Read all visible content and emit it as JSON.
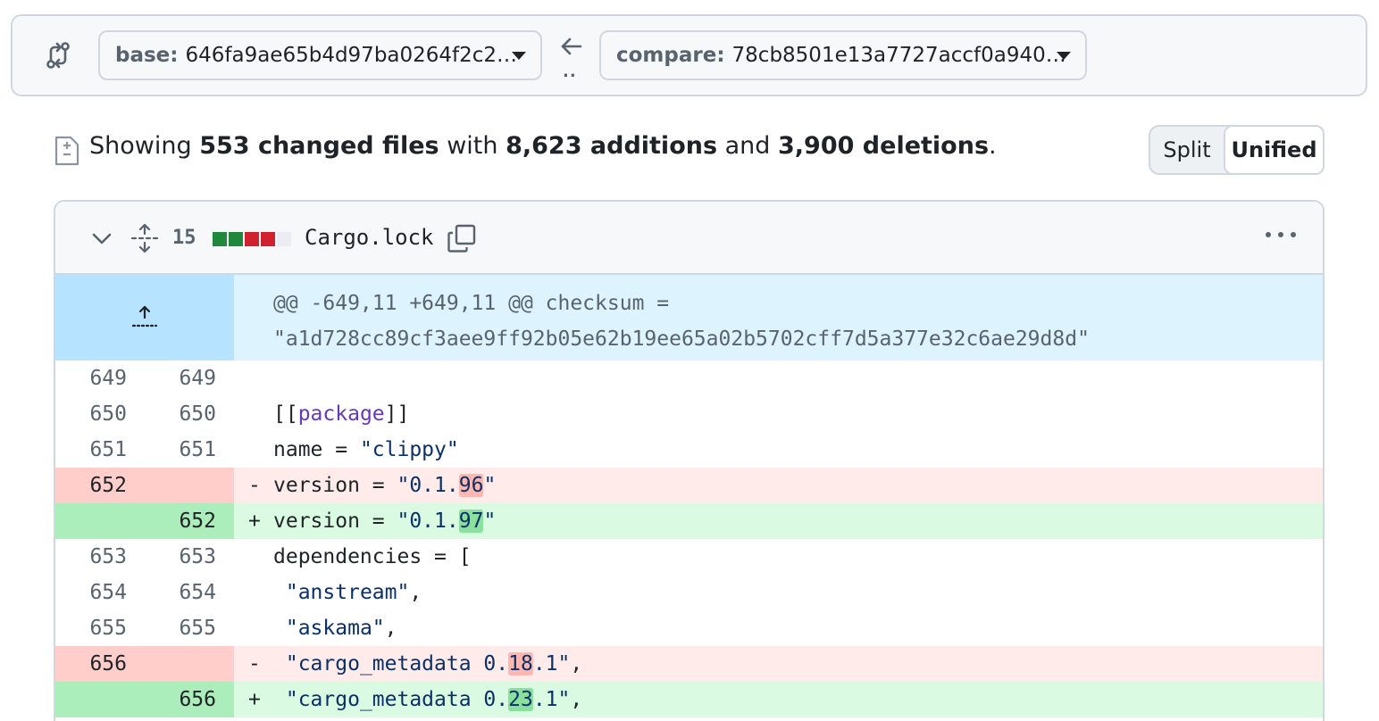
{
  "compare_bar": {
    "base_label": "base:",
    "base_sha": "646fa9ae65b4d97ba0264f2c2…",
    "compare_label": "compare:",
    "compare_sha": "78cb8501e13a7727accf0a940…",
    "dots": ".."
  },
  "summary": {
    "prefix": "Showing ",
    "files": "553 changed files",
    "mid1": " with ",
    "additions": "8,623 additions",
    "mid2": " and ",
    "deletions": "3,900 deletions",
    "suffix": "."
  },
  "view_toggle": {
    "split": "Split",
    "unified": "Unified",
    "selected": "Unified"
  },
  "file": {
    "change_count": "15",
    "name": "Cargo.lock",
    "diffstat_colors": [
      "#1f883d",
      "#1f883d",
      "#cf222e",
      "#cf222e",
      "#eaeef2"
    ]
  },
  "hunk": {
    "header": "@@ -649,11 +649,11 @@ checksum = \"a1d728cc89cf3aee9ff92b05e62b19ee65a02b5702cff7d5a377e32c6ae29d8d\""
  },
  "lines": [
    {
      "type": "ctx",
      "old": "649",
      "new": "649",
      "marker": "",
      "parts": []
    },
    {
      "type": "ctx",
      "old": "650",
      "new": "650",
      "marker": "",
      "parts": [
        {
          "t": "[[",
          "c": ""
        },
        {
          "t": "package",
          "c": "kw"
        },
        {
          "t": "]]",
          "c": ""
        }
      ]
    },
    {
      "type": "ctx",
      "old": "651",
      "new": "651",
      "marker": "",
      "parts": [
        {
          "t": "name = ",
          "c": ""
        },
        {
          "t": "\"clippy\"",
          "c": "str"
        }
      ]
    },
    {
      "type": "del",
      "old": "652",
      "new": "",
      "marker": "-",
      "parts": [
        {
          "t": "version = ",
          "c": ""
        },
        {
          "t": "\"0.1.",
          "c": "str"
        },
        {
          "t": "96",
          "c": "str hl-del"
        },
        {
          "t": "\"",
          "c": "str"
        }
      ]
    },
    {
      "type": "add",
      "old": "",
      "new": "652",
      "marker": "+",
      "parts": [
        {
          "t": "version = ",
          "c": ""
        },
        {
          "t": "\"0.1.",
          "c": "str"
        },
        {
          "t": "97",
          "c": "str hl-add"
        },
        {
          "t": "\"",
          "c": "str"
        }
      ]
    },
    {
      "type": "ctx",
      "old": "653",
      "new": "653",
      "marker": "",
      "parts": [
        {
          "t": "dependencies = [",
          "c": ""
        }
      ]
    },
    {
      "type": "ctx",
      "old": "654",
      "new": "654",
      "marker": "",
      "parts": [
        {
          "t": " ",
          "c": ""
        },
        {
          "t": "\"anstream\"",
          "c": "str"
        },
        {
          "t": ",",
          "c": ""
        }
      ]
    },
    {
      "type": "ctx",
      "old": "655",
      "new": "655",
      "marker": "",
      "parts": [
        {
          "t": " ",
          "c": ""
        },
        {
          "t": "\"askama\"",
          "c": "str"
        },
        {
          "t": ",",
          "c": ""
        }
      ]
    },
    {
      "type": "del",
      "old": "656",
      "new": "",
      "marker": "-",
      "parts": [
        {
          "t": " ",
          "c": ""
        },
        {
          "t": "\"cargo_metadata 0.",
          "c": "str"
        },
        {
          "t": "18",
          "c": "str hl-del"
        },
        {
          "t": ".1\"",
          "c": "str"
        },
        {
          "t": ",",
          "c": ""
        }
      ]
    },
    {
      "type": "add",
      "old": "",
      "new": "656",
      "marker": "+",
      "parts": [
        {
          "t": " ",
          "c": ""
        },
        {
          "t": "\"cargo_metadata 0.",
          "c": "str"
        },
        {
          "t": "23",
          "c": "str hl-add"
        },
        {
          "t": ".1\"",
          "c": "str"
        },
        {
          "t": ",",
          "c": ""
        }
      ]
    }
  ]
}
